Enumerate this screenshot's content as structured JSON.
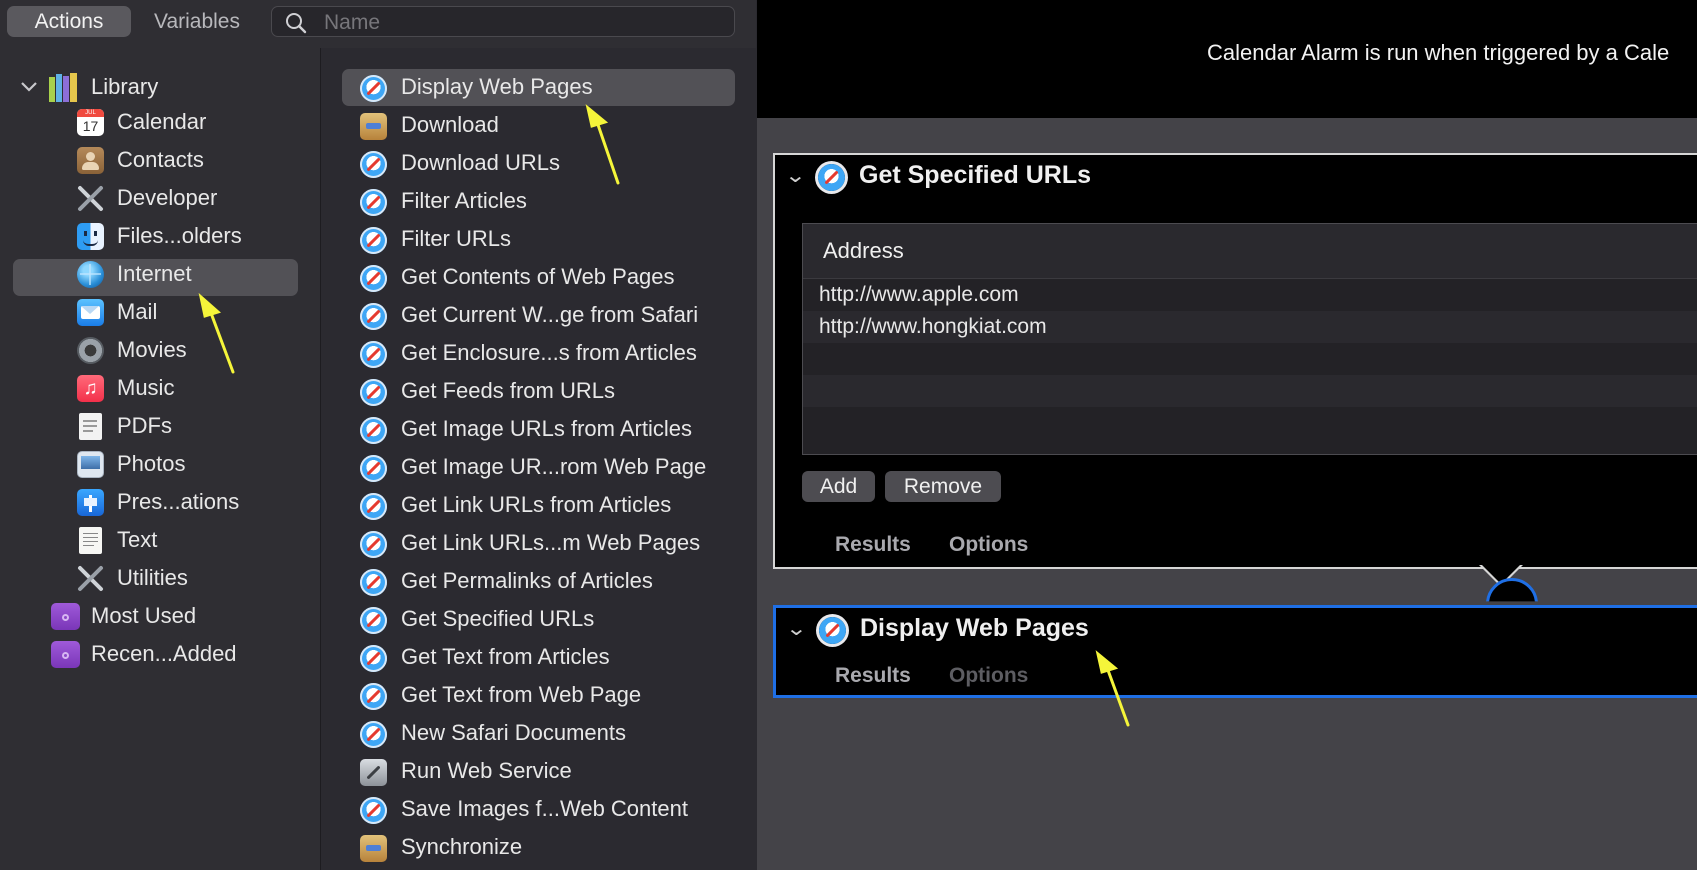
{
  "toolbar": {
    "tabs": [
      {
        "label": "Actions",
        "selected": true
      },
      {
        "label": "Variables",
        "selected": false
      }
    ],
    "search_placeholder": "Name"
  },
  "library": {
    "root_label": "Library",
    "items": [
      {
        "label": "Calendar",
        "icon": "calendar-icon",
        "calendar_date": "17",
        "calendar_month": "JUL"
      },
      {
        "label": "Contacts",
        "icon": "contacts-icon"
      },
      {
        "label": "Developer",
        "icon": "developer-tools-icon"
      },
      {
        "label": "Files...olders",
        "icon": "finder-icon"
      },
      {
        "label": "Internet",
        "icon": "globe-icon",
        "selected": true
      },
      {
        "label": "Mail",
        "icon": "mail-icon"
      },
      {
        "label": "Movies",
        "icon": "movies-icon"
      },
      {
        "label": "Music",
        "icon": "music-icon"
      },
      {
        "label": "PDFs",
        "icon": "pdf-icon"
      },
      {
        "label": "Photos",
        "icon": "photos-icon"
      },
      {
        "label": "Pres...ations",
        "icon": "keynote-icon"
      },
      {
        "label": "Text",
        "icon": "text-icon"
      },
      {
        "label": "Utilities",
        "icon": "utilities-icon"
      }
    ],
    "smart_groups": [
      {
        "label": "Most Used",
        "icon": "smart-folder-icon"
      },
      {
        "label": "Recen...Added",
        "icon": "smart-folder-icon"
      }
    ]
  },
  "actions": [
    {
      "label": "Display Web Pages",
      "icon": "safari-icon",
      "selected": true
    },
    {
      "label": "Download",
      "icon": "package-icon"
    },
    {
      "label": "Download URLs",
      "icon": "safari-icon"
    },
    {
      "label": "Filter Articles",
      "icon": "safari-icon"
    },
    {
      "label": "Filter URLs",
      "icon": "safari-icon"
    },
    {
      "label": "Get Contents of Web Pages",
      "icon": "safari-icon"
    },
    {
      "label": "Get Current W...ge from Safari",
      "icon": "safari-icon"
    },
    {
      "label": "Get Enclosure...s from Articles",
      "icon": "safari-icon"
    },
    {
      "label": "Get Feeds from URLs",
      "icon": "safari-icon"
    },
    {
      "label": "Get Image URLs from Articles",
      "icon": "safari-icon"
    },
    {
      "label": "Get Image UR...rom Web Page",
      "icon": "safari-icon"
    },
    {
      "label": "Get Link URLs from Articles",
      "icon": "safari-icon"
    },
    {
      "label": "Get Link URLs...m Web Pages",
      "icon": "safari-icon"
    },
    {
      "label": "Get Permalinks of Articles",
      "icon": "safari-icon"
    },
    {
      "label": "Get Specified URLs",
      "icon": "safari-icon"
    },
    {
      "label": "Get Text from Articles",
      "icon": "safari-icon"
    },
    {
      "label": "Get Text from Web Page",
      "icon": "safari-icon"
    },
    {
      "label": "New Safari Documents",
      "icon": "safari-icon"
    },
    {
      "label": "Run Web Service",
      "icon": "web-service-icon"
    },
    {
      "label": "Save Images f...Web Content",
      "icon": "safari-icon"
    },
    {
      "label": "Synchronize",
      "icon": "package-icon"
    }
  ],
  "workflow": {
    "header_text": "Calendar Alarm is run when triggered by a Cale",
    "cards": [
      {
        "title": "Get Specified URLs",
        "table_header": "Address",
        "urls": [
          "http://www.apple.com",
          "http://www.hongkiat.com"
        ],
        "add_label": "Add",
        "remove_label": "Remove",
        "results_label": "Results",
        "options_label": "Options"
      },
      {
        "title": "Display Web Pages",
        "results_label": "Results",
        "options_label": "Options",
        "options_disabled": true
      }
    ]
  },
  "colors": {
    "selection": "#525156",
    "card_focus_border": "#1f6fe5",
    "annotation_arrow": "#f5f53a"
  }
}
